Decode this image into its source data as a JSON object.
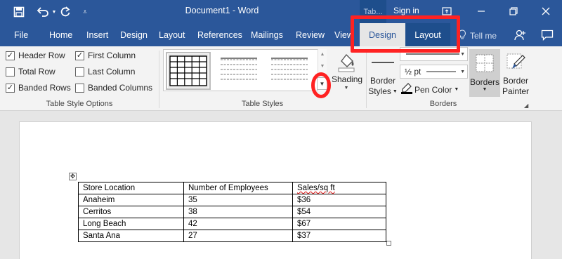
{
  "titlebar": {
    "document_title": "Document1  -  Word",
    "context_tab_group": "Tab...",
    "sign_in": "Sign in"
  },
  "tabs": {
    "file": "File",
    "home": "Home",
    "insert": "Insert",
    "design": "Design",
    "layout": "Layout",
    "references": "References",
    "mailings": "Mailings",
    "review": "Review",
    "view": "View",
    "table_design": "Design",
    "table_layout": "Layout",
    "tell_me": "Tell me"
  },
  "table_style_options": {
    "group_label": "Table Style Options",
    "header_row": {
      "label": "Header Row",
      "checked": true
    },
    "total_row": {
      "label": "Total Row",
      "checked": false
    },
    "banded_rows": {
      "label": "Banded Rows",
      "checked": true
    },
    "first_column": {
      "label": "First Column",
      "checked": true
    },
    "last_column": {
      "label": "Last Column",
      "checked": false
    },
    "banded_columns": {
      "label": "Banded Columns",
      "checked": false
    }
  },
  "table_styles": {
    "group_label": "Table Styles",
    "shading_label": "Shading"
  },
  "borders_group": {
    "group_label": "Borders",
    "border_styles_label_1": "Border",
    "border_styles_label_2": "Styles",
    "line_weight": "½ pt",
    "pen_color": "Pen Color",
    "borders_label": "Borders",
    "border_painter_label_1": "Border",
    "border_painter_label_2": "Painter"
  },
  "document_table": {
    "rows": [
      [
        "Store Location",
        "Number of Employees",
        "Sales/sq ft"
      ],
      [
        "Anaheim",
        "35",
        "$36"
      ],
      [
        "Cerritos",
        "38",
        "$54"
      ],
      [
        "Long Beach",
        "42",
        "$67"
      ],
      [
        "Santa Ana",
        "27",
        "$37"
      ]
    ]
  },
  "colors": {
    "accent": "#2b579a",
    "annotation": "#ff2222"
  }
}
